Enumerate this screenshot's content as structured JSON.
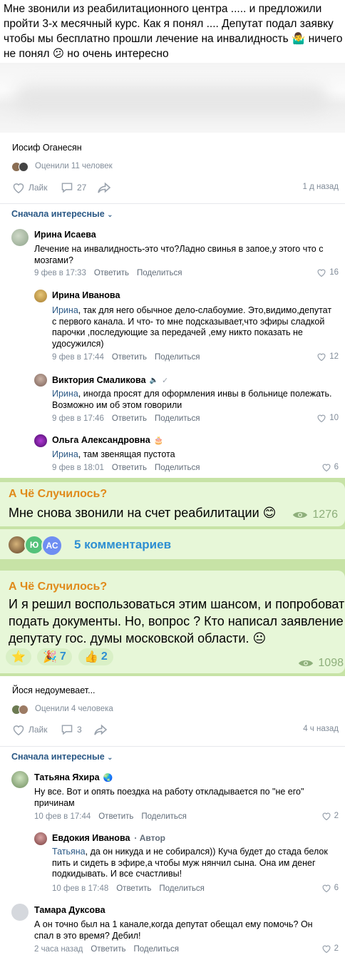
{
  "post": {
    "text": "Мне звонили из реабилитационного центра ..... и предложили пройти 3-х месячный курс. Как я понял .... Депутат подал заявку чтобы мы бесплатно прошли лечение на инвалидность 🤷‍♂️ ничего не понял 😕 но очень интересно",
    "author": "Иосиф Оганесян",
    "rated": "Оценили 11 человек",
    "like_label": "Лайк",
    "comments_count": "27",
    "time": "1 д назад"
  },
  "thread1": {
    "sort_label": "Сначала интересные",
    "comments": [
      {
        "author": "Ирина Исаева",
        "text": "Лечение на инвалидность-это что?Ладно свинья в запое,у этого что с мозгами?",
        "date": "9 фев в 17:33",
        "reply": "Ответить",
        "share": "Поделиться",
        "likes": "16"
      },
      {
        "author": "Ирина Иванова",
        "mention": "Ирина",
        "text": ", так для него обычное дело-слабоумие. Это,видимо,депутат с первого канала. И что- то мне подсказывает,что эфиры сладкой парочки ,последующие за передачей ,ему никто показать не удосужился)",
        "date": "9 фев в 17:44",
        "reply": "Ответить",
        "share": "Поделиться",
        "likes": "12"
      },
      {
        "author": "Виктория Смаликова",
        "mention": "Ирина",
        "text": ", иногда просят для оформления инвы в больнице полежать. Возможно им об этом говорили",
        "date": "9 фев в 17:46",
        "reply": "Ответить",
        "share": "Поделиться",
        "likes": "10"
      },
      {
        "author": "Ольга Александровна",
        "mention": "Ирина",
        "text": ", там звенящая пустота",
        "date": "9 фев в 18:01",
        "reply": "Ответить",
        "share": "Поделиться",
        "likes": "6"
      }
    ]
  },
  "tg1": {
    "channel": "А Чё Случилось?",
    "text": "Мне снова звонили на счет реабилитации 😊",
    "views": "1276",
    "av1": "Ю",
    "av2": "АС",
    "comments": "5 комментариев"
  },
  "tg2": {
    "channel": "А Чё Случилось?",
    "text": "И я решил воспользоваться этим шансом, и попробоват подать документы. Но, вопрос ? Кто написал заявление депутату гос. думы московской области. 😐",
    "r1": "⭐",
    "r2": "🎉",
    "r2n": "7",
    "r3": "👍",
    "r3n": "2",
    "views": "1098"
  },
  "post2": {
    "author": "Йося недоумевает...",
    "rated": "Оценили 4 человека",
    "like_label": "Лайк",
    "comments_count": "3",
    "time": "4 ч назад"
  },
  "thread2": {
    "sort_label": "Сначала интересные",
    "comments": [
      {
        "author": "Татьяна Яхира",
        "text": "Ну все. Вот и опять поездка на работу откладывается по \"не его\" причинам",
        "date": "10 фев в 17:44",
        "reply": "Ответить",
        "share": "Поделиться",
        "likes": "2"
      },
      {
        "author": "Евдокия Иванова",
        "badge": "· Автор",
        "mention": "Татьяна",
        "text": ", да он никуда и не собирался)) Куча будет до стада белок пить и сидеть в эфире,а чтобы муж нянчил сына. Она им денег подкидывать. И все счастливы!",
        "date": "10 фев в 17:48",
        "reply": "Ответить",
        "share": "Поделиться",
        "likes": "6"
      },
      {
        "author": "Тамара Дуксова",
        "text": "А он точно был на 1 канале,когда депутат обещал ему помочь? Он спал в это время? Дебил!",
        "date": "2 часа назад",
        "reply": "Ответить",
        "share": "Поделиться",
        "likes": "2"
      }
    ]
  }
}
